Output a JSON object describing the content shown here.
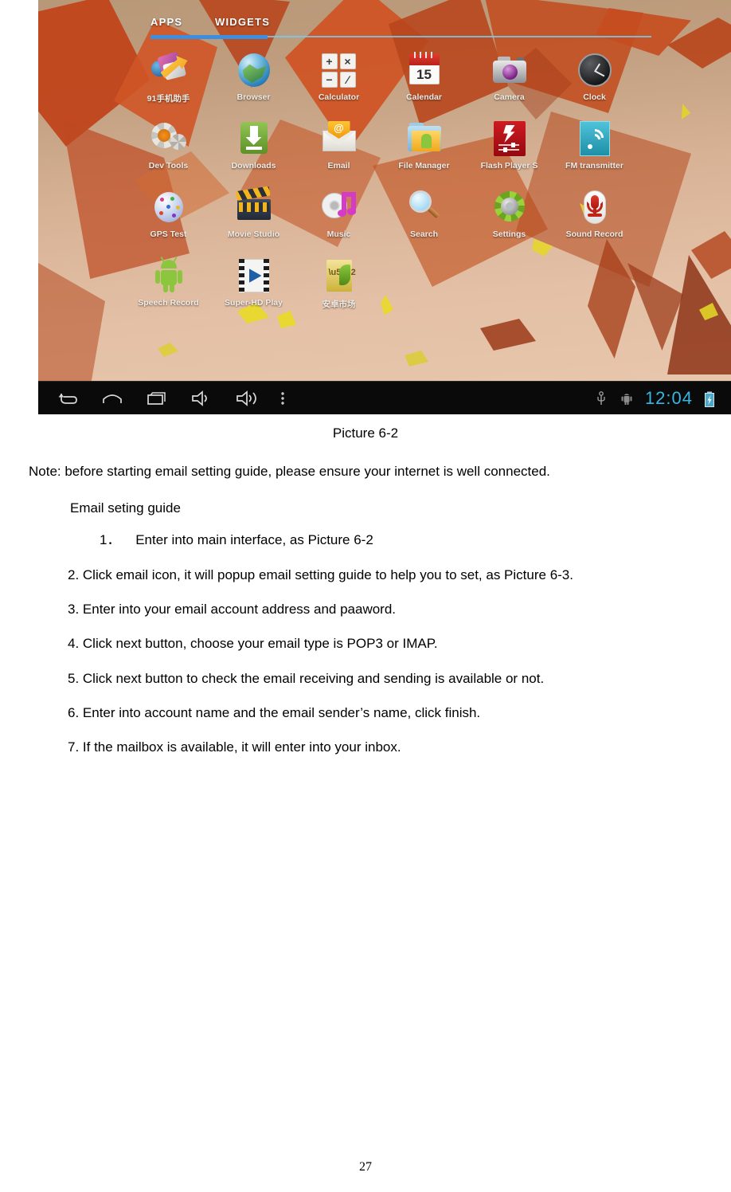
{
  "screenshot": {
    "launcher": {
      "tabs": [
        {
          "label": "APPS",
          "selected": true
        },
        {
          "label": "WIDGETS",
          "selected": false
        }
      ],
      "accent_color": "#3d8ee0",
      "rule_color": "#79c9ef",
      "apps": [
        {
          "label": "91手机助手",
          "icon": "assistant-91-icon"
        },
        {
          "label": "Browser",
          "icon": "browser-globe-icon"
        },
        {
          "label": "Calculator",
          "icon": "calculator-icon",
          "keys": [
            "+",
            "×",
            "−",
            "∕"
          ]
        },
        {
          "label": "Calendar",
          "icon": "calendar-icon",
          "day": "15"
        },
        {
          "label": "Camera",
          "icon": "camera-icon"
        },
        {
          "label": "Clock",
          "icon": "clock-icon"
        },
        {
          "label": "Dev Tools",
          "icon": "dev-tools-gears-icon"
        },
        {
          "label": "Downloads",
          "icon": "downloads-arrow-icon"
        },
        {
          "label": "Email",
          "icon": "email-envelope-icon",
          "badge": "@"
        },
        {
          "label": "File Manager",
          "icon": "file-manager-folder-icon"
        },
        {
          "label": "Flash Player S",
          "icon": "flash-player-settings-icon"
        },
        {
          "label": "FM transmitter",
          "icon": "fm-transmitter-icon"
        },
        {
          "label": "GPS Test",
          "icon": "gps-test-icon"
        },
        {
          "label": "Movie Studio",
          "icon": "movie-studio-clapper-icon"
        },
        {
          "label": "Music",
          "icon": "music-cd-note-icon"
        },
        {
          "label": "Search",
          "icon": "search-magnifier-icon"
        },
        {
          "label": "Settings",
          "icon": "settings-gear-icon"
        },
        {
          "label": "Sound Record",
          "icon": "sound-recorder-mic-icon"
        },
        {
          "label": "Speech Record",
          "icon": "speech-recorder-android-icon"
        },
        {
          "label": "Super-HD Play",
          "icon": "super-hd-player-film-icon"
        },
        {
          "label": "安卓市场",
          "icon": "android-market-icon"
        }
      ]
    },
    "system_bar": {
      "nav": [
        {
          "name": "back-icon"
        },
        {
          "name": "home-icon"
        },
        {
          "name": "recent-apps-icon"
        },
        {
          "name": "volume-down-icon"
        },
        {
          "name": "volume-up-icon"
        },
        {
          "name": "menu-overflow-icon"
        }
      ],
      "status": [
        {
          "name": "usb-icon"
        },
        {
          "name": "android-debug-icon"
        }
      ],
      "clock": "12:04",
      "clock_color": "#35b7e2",
      "battery": {
        "name": "battery-charging-icon",
        "color": "#57b4d6"
      }
    }
  },
  "document": {
    "caption": "Picture 6-2",
    "note": "Note: before starting email setting guide, please ensure your internet is well connected.",
    "guide_title": "Email seting guide",
    "steps": [
      {
        "number": "1．",
        "text": "Enter into main interface, as Picture 6-2"
      },
      {
        "number": "",
        "text": "2. Click email icon, it will popup email setting guide to help you to set, as Picture 6-3."
      },
      {
        "number": "",
        "text": "3. Enter into your email account address and paaword."
      },
      {
        "number": "",
        "text": "4. Click next button, choose your email type is POP3 or IMAP."
      },
      {
        "number": "",
        "text": "5. Click next button to check the email receiving and sending is available or not."
      },
      {
        "number": "",
        "text": "6. Enter into account name and the email sender’s name, click finish."
      },
      {
        "number": "",
        "text": "7. If the mailbox is available, it will enter into your inbox."
      }
    ],
    "page_number": "27"
  }
}
